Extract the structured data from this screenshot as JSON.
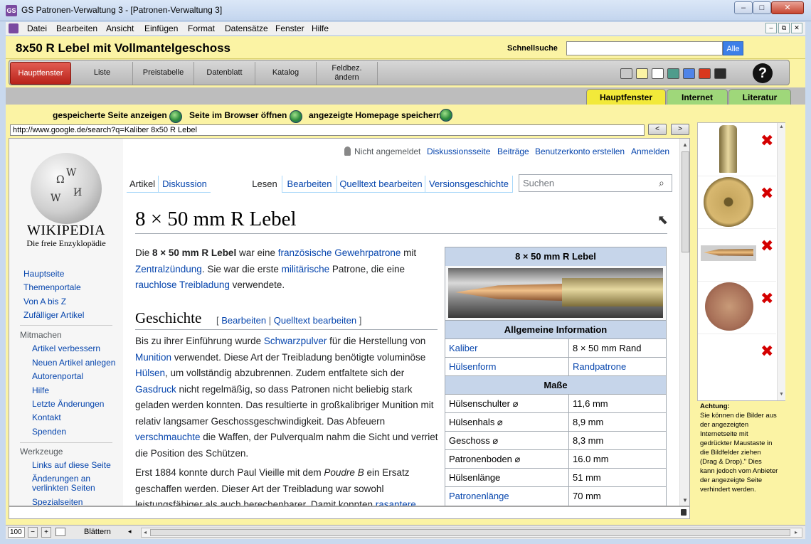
{
  "window": {
    "title": "GS Patronen-Verwaltung 3 - [Patronen-Verwaltung 3]",
    "minimize": "–",
    "maximize": "□",
    "close": "✕"
  },
  "menu": {
    "items": [
      "Datei",
      "Bearbeiten",
      "Ansicht",
      "Einfügen",
      "Format",
      "Datensätze",
      "Fenster",
      "Hilfe"
    ],
    "mdi": [
      "–",
      "⧉",
      "✕"
    ]
  },
  "header": {
    "record_title": "8x50 R Lebel mit Vollmantelgeschoss",
    "quicksearch_label": "Schnellsuche",
    "quicksearch_value": "",
    "alle_label": "Alle"
  },
  "toolbar": {
    "buttons": [
      "Hauptfenster",
      "Liste",
      "Preistabelle",
      "Datenblatt",
      "Katalog"
    ],
    "feldbez_line1": "Feldbez.",
    "feldbez_line2": "ändern",
    "help": "?",
    "swatches": [
      "#c8c8c8",
      "#fbf3a4",
      "#ffffff",
      "#4f9c8c",
      "#4f84e8",
      "#d9381e",
      "#2b2b2b"
    ]
  },
  "tabs": [
    "Hauptfenster",
    "Internet",
    "Literatur"
  ],
  "internet": {
    "show_saved": "gespeicherte Seite anzeigen",
    "open_browser": "Seite im Browser öffnen",
    "save_homepage": "angezeigte Homepage speichern",
    "url": "http://www.google.de/search?q=Kaliber 8x50 R Lebel",
    "back": "<",
    "forward": ">"
  },
  "wikipedia": {
    "wordmark": "WIKIPEDIA",
    "tagline": "Die freie Enzyklopädie",
    "personal": {
      "not_logged": "Nicht angemeldet",
      "talk": "Diskussionsseite",
      "contrib": "Beiträge",
      "create": "Benutzerkonto erstellen",
      "login": "Anmelden"
    },
    "nav": [
      "Hauptseite",
      "Themenportale",
      "Von A bis Z",
      "Zufälliger Artikel"
    ],
    "mitmachen_heading": "Mitmachen",
    "mitmachen": [
      "Artikel verbessern",
      "Neuen Artikel anlegen",
      "Autorenportal",
      "Hilfe",
      "Letzte Änderungen",
      "Kontakt",
      "Spenden"
    ],
    "werkzeuge_heading": "Werkzeuge",
    "werkzeuge": [
      "Links auf diese Seite",
      "Änderungen an verlinkten Seiten",
      "Spezialseiten"
    ],
    "tabs": {
      "article": "Artikel",
      "discussion": "Diskussion",
      "read": "Lesen",
      "edit": "Bearbeiten",
      "source": "Quelltext bearbeiten",
      "history": "Versionsgeschichte"
    },
    "search_placeholder": "Suchen",
    "title": "8 × 50 mm R Lebel",
    "intro": {
      "t1": "Die ",
      "bold": "8 × 50 mm R Lebel",
      "t2": " war eine ",
      "l1": "französische",
      "t3": " ",
      "l2": "Gewehrpatrone",
      "t4": " mit ",
      "l3": "Zentralzündung",
      "t5": ". Sie war die erste ",
      "l4": "militärische",
      "t6": " Patrone, die eine ",
      "l5": "rauchlose Treibladung",
      "t7": " verwendete."
    },
    "history_heading": "Geschichte",
    "edit_links": {
      "open": "[ ",
      "edit": "Bearbeiten",
      "sep": " | ",
      "source": "Quelltext bearbeiten",
      "close": " ]"
    },
    "p2": {
      "t1": "Bis zu ihrer Einführung wurde ",
      "l1": "Schwarzpulver",
      "t2": " für die Herstellung von ",
      "l2": "Munition",
      "t3": " verwendet. Diese Art der Treibladung benötigte voluminöse ",
      "l3": "Hülsen",
      "t4": ", um vollständig abzubrennen. Zudem entfaltete sich der ",
      "l4": "Gasdruck",
      "t5": " nicht regelmäßig, so dass Patronen nicht beliebig stark geladen werden konnten. Das resultierte in großkalibriger Munition mit relativ langsamer Geschossgeschwindigkeit. Das Abfeuern ",
      "l5": "verschmauchte",
      "t6": " die Waffen, der Pulverqualm nahm die Sicht und verriet die Position des Schützen."
    },
    "p3": {
      "t1": "Erst 1884 konnte durch Paul Vieille mit dem ",
      "i1": "Poudre B",
      "t2": " ein Ersatz geschaffen werden. Dieser Art der Treibladung war sowohl leistungsfähiger als auch berechenbarer. Damit konnten ",
      "l1": "rasantere"
    },
    "infobox": {
      "title": "8 × 50 mm R Lebel",
      "section1": "Allgemeine Information",
      "rows1": [
        {
          "k": "Kaliber",
          "v": "8 × 50 mm Rand"
        },
        {
          "k": "Hülsenform",
          "v": "Randpatrone"
        }
      ],
      "section2": "Maße",
      "rows2": [
        {
          "k": "Hülsenschulter ⌀",
          "v": "11,6 mm"
        },
        {
          "k": "Hülsenhals ⌀",
          "v": "8,9 mm"
        },
        {
          "k": "Geschoss ⌀",
          "v": "8,3 mm"
        },
        {
          "k": "Patronenboden ⌀",
          "v": "16.0 mm"
        },
        {
          "k": "Hülsenlänge",
          "v": "51 mm"
        },
        {
          "k": "Patronenlänge",
          "v": "70 mm"
        }
      ]
    }
  },
  "images_panel": {
    "delete_icon": "✖",
    "warning_title": "Achtung:",
    "warning_text": "Sie können die Bilder aus der angezeigten Internetseite mit gedrückter Maustaste in die Bildfelder ziehen (Drag & Drop).\" Dies kann jedoch vom Anbieter der angezeigte Seite verhindert werden."
  },
  "statusbar": {
    "zoom": "100",
    "mode": "Blättern"
  }
}
